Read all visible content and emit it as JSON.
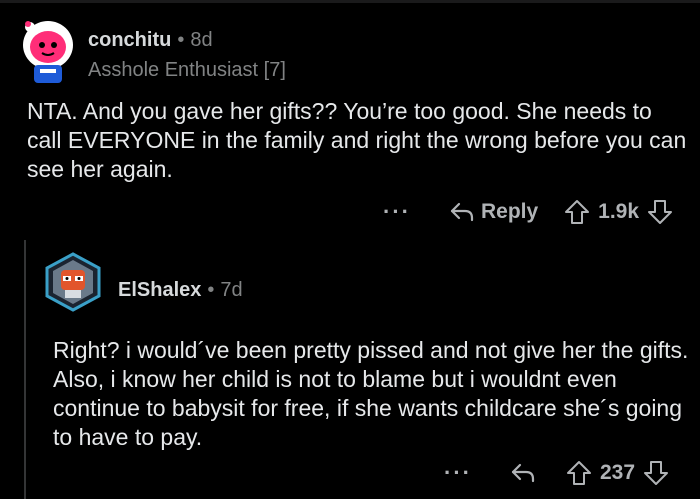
{
  "comments": [
    {
      "username": "conchitu",
      "separator": "•",
      "time": "8d",
      "flair": "Asshole Enthusiast [7]",
      "body": "NTA. And you gave her gifts?? You’re too good. She needs to call EVERYONE in the family and right the wrong before you can see her again.",
      "more_label": "···",
      "reply_label": "Reply",
      "votes": "1.9k",
      "avatar_icon": "snoo-avatar-icon",
      "colors": {
        "avatar_head": "#ff2d78",
        "avatar_hood": "#ffffff",
        "avatar_body": "#1e5bd8"
      }
    },
    {
      "username": "ElShalex",
      "separator": "•",
      "time": "7d",
      "body": "Right? i would´ve been pretty pissed  and not give her the gifts. Also, i know her child is not to blame but i wouldnt even continue to babysit for free, if she wants childcare she´s going to have to pay.",
      "more_label": "···",
      "votes": "237",
      "avatar_icon": "robot-avatar-icon",
      "colors": {
        "avatar_ring": "#3aa0c8",
        "avatar_face": "#e2552b"
      }
    }
  ]
}
